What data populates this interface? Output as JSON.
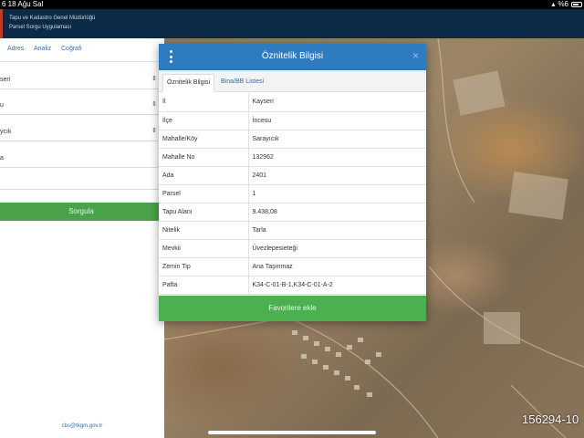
{
  "status_bar": {
    "time": "6 18 Ağu Sal",
    "battery": "%6"
  },
  "app_header": {
    "line1": "Tapu ve Kadastro Genel Müdürlüğü",
    "line2": "Parsel Sorgu Uygulaması"
  },
  "left_panel": {
    "nav": [
      "Adres",
      "Analiz",
      "Coğrafi"
    ],
    "selects": [
      "seri",
      "u",
      "ycık"
    ],
    "text_field": "a",
    "search_button": "Sorgula",
    "footer_email": "cbs@tkgm.gov.tr"
  },
  "map": {
    "coordinate": "156294-10"
  },
  "modal": {
    "title": "Öznitelik Bilgisi",
    "close_label": "×",
    "tabs": [
      "Öznitelik Bilgisi",
      "Bina/BB Listesi"
    ],
    "rows": [
      {
        "key": "İl",
        "value": "Kayseri"
      },
      {
        "key": "İlçe",
        "value": "İncesu"
      },
      {
        "key": "Mahalle/Köy",
        "value": "Sarayıcık"
      },
      {
        "key": "Mahalle No",
        "value": "132962"
      },
      {
        "key": "Ada",
        "value": "2401"
      },
      {
        "key": "Parsel",
        "value": "1"
      },
      {
        "key": "Tapu Alanı",
        "value": "9.438,08"
      },
      {
        "key": "Nitelik",
        "value": "Tarla"
      },
      {
        "key": "Mevkii",
        "value": "Üvezlepesieteği"
      },
      {
        "key": "Zemin Tip",
        "value": "Ana Taşınmaz"
      },
      {
        "key": "Pafta",
        "value": "K34-C-01-B-1,K34-C-01-A-2"
      }
    ],
    "favorite_button": "Favorilere ekle"
  },
  "colors": {
    "header_blue": "#2f7bc0",
    "green": "#4caf50",
    "app_navy": "#0a2a45"
  }
}
